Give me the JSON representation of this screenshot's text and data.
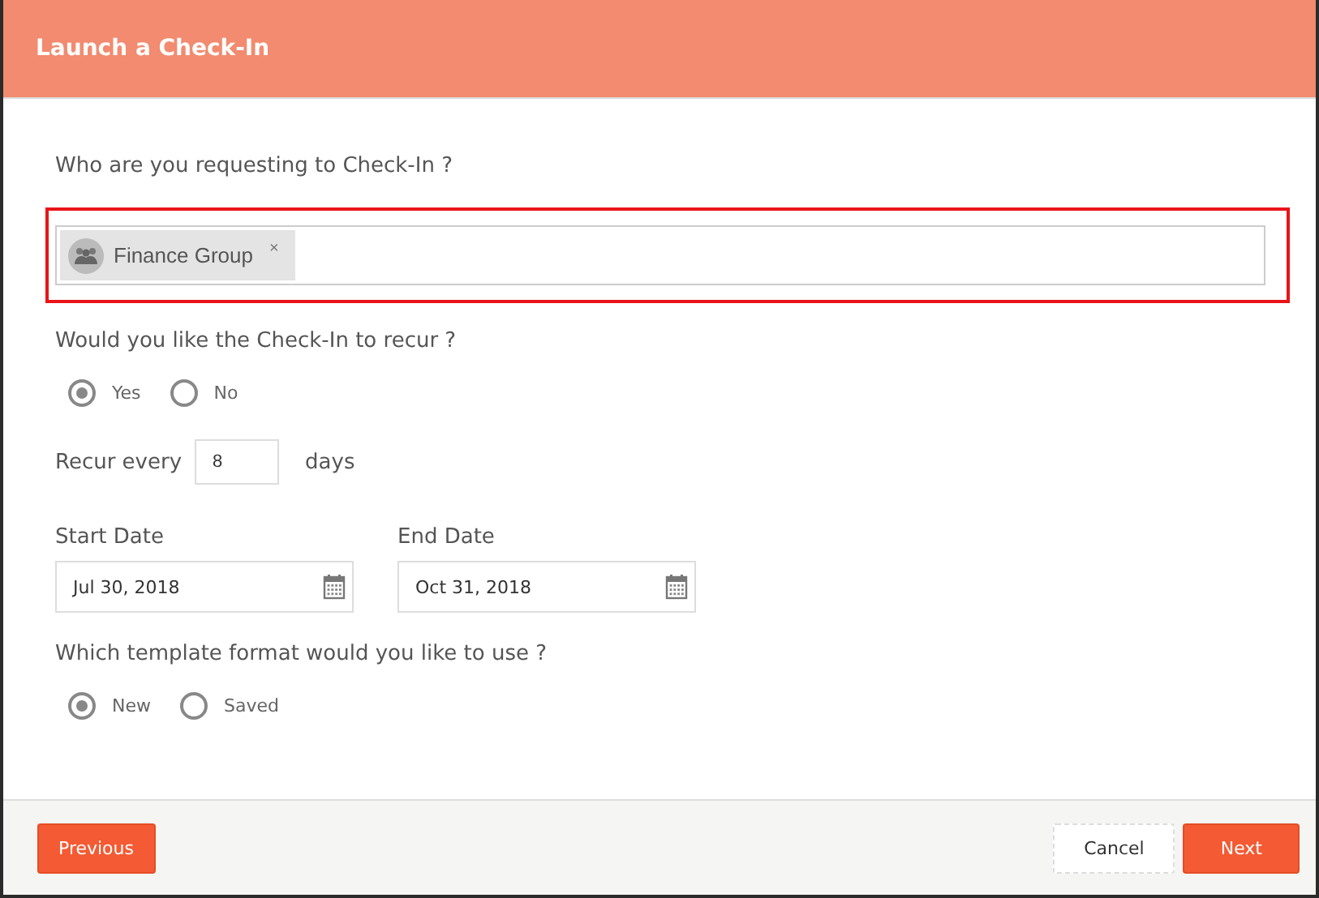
{
  "dialog": {
    "title": "Launch a Check-In"
  },
  "recipients": {
    "label": "Who are you requesting to Check-In ?",
    "highlighted": true,
    "chips": [
      {
        "label": "Finance Group",
        "remove": "×"
      }
    ]
  },
  "recur": {
    "label": "Would you like the Check-In to recur ?",
    "options": [
      {
        "label": "Yes",
        "selected": true
      },
      {
        "label": "No",
        "selected": false
      }
    ]
  },
  "interval": {
    "prefix": "Recur every",
    "value": "8",
    "suffix": "days"
  },
  "dates": [
    {
      "label": "Start Date",
      "value": "Jul 30, 2018"
    },
    {
      "label": "End Date",
      "value": "Oct 31, 2018"
    }
  ],
  "template": {
    "label": "Which template format would you like to use ?",
    "options": [
      {
        "label": "New",
        "selected": true
      },
      {
        "label": "Saved",
        "selected": false
      }
    ]
  },
  "footer": {
    "previous": "Previous",
    "cancel": "Cancel",
    "next": "Next"
  }
}
